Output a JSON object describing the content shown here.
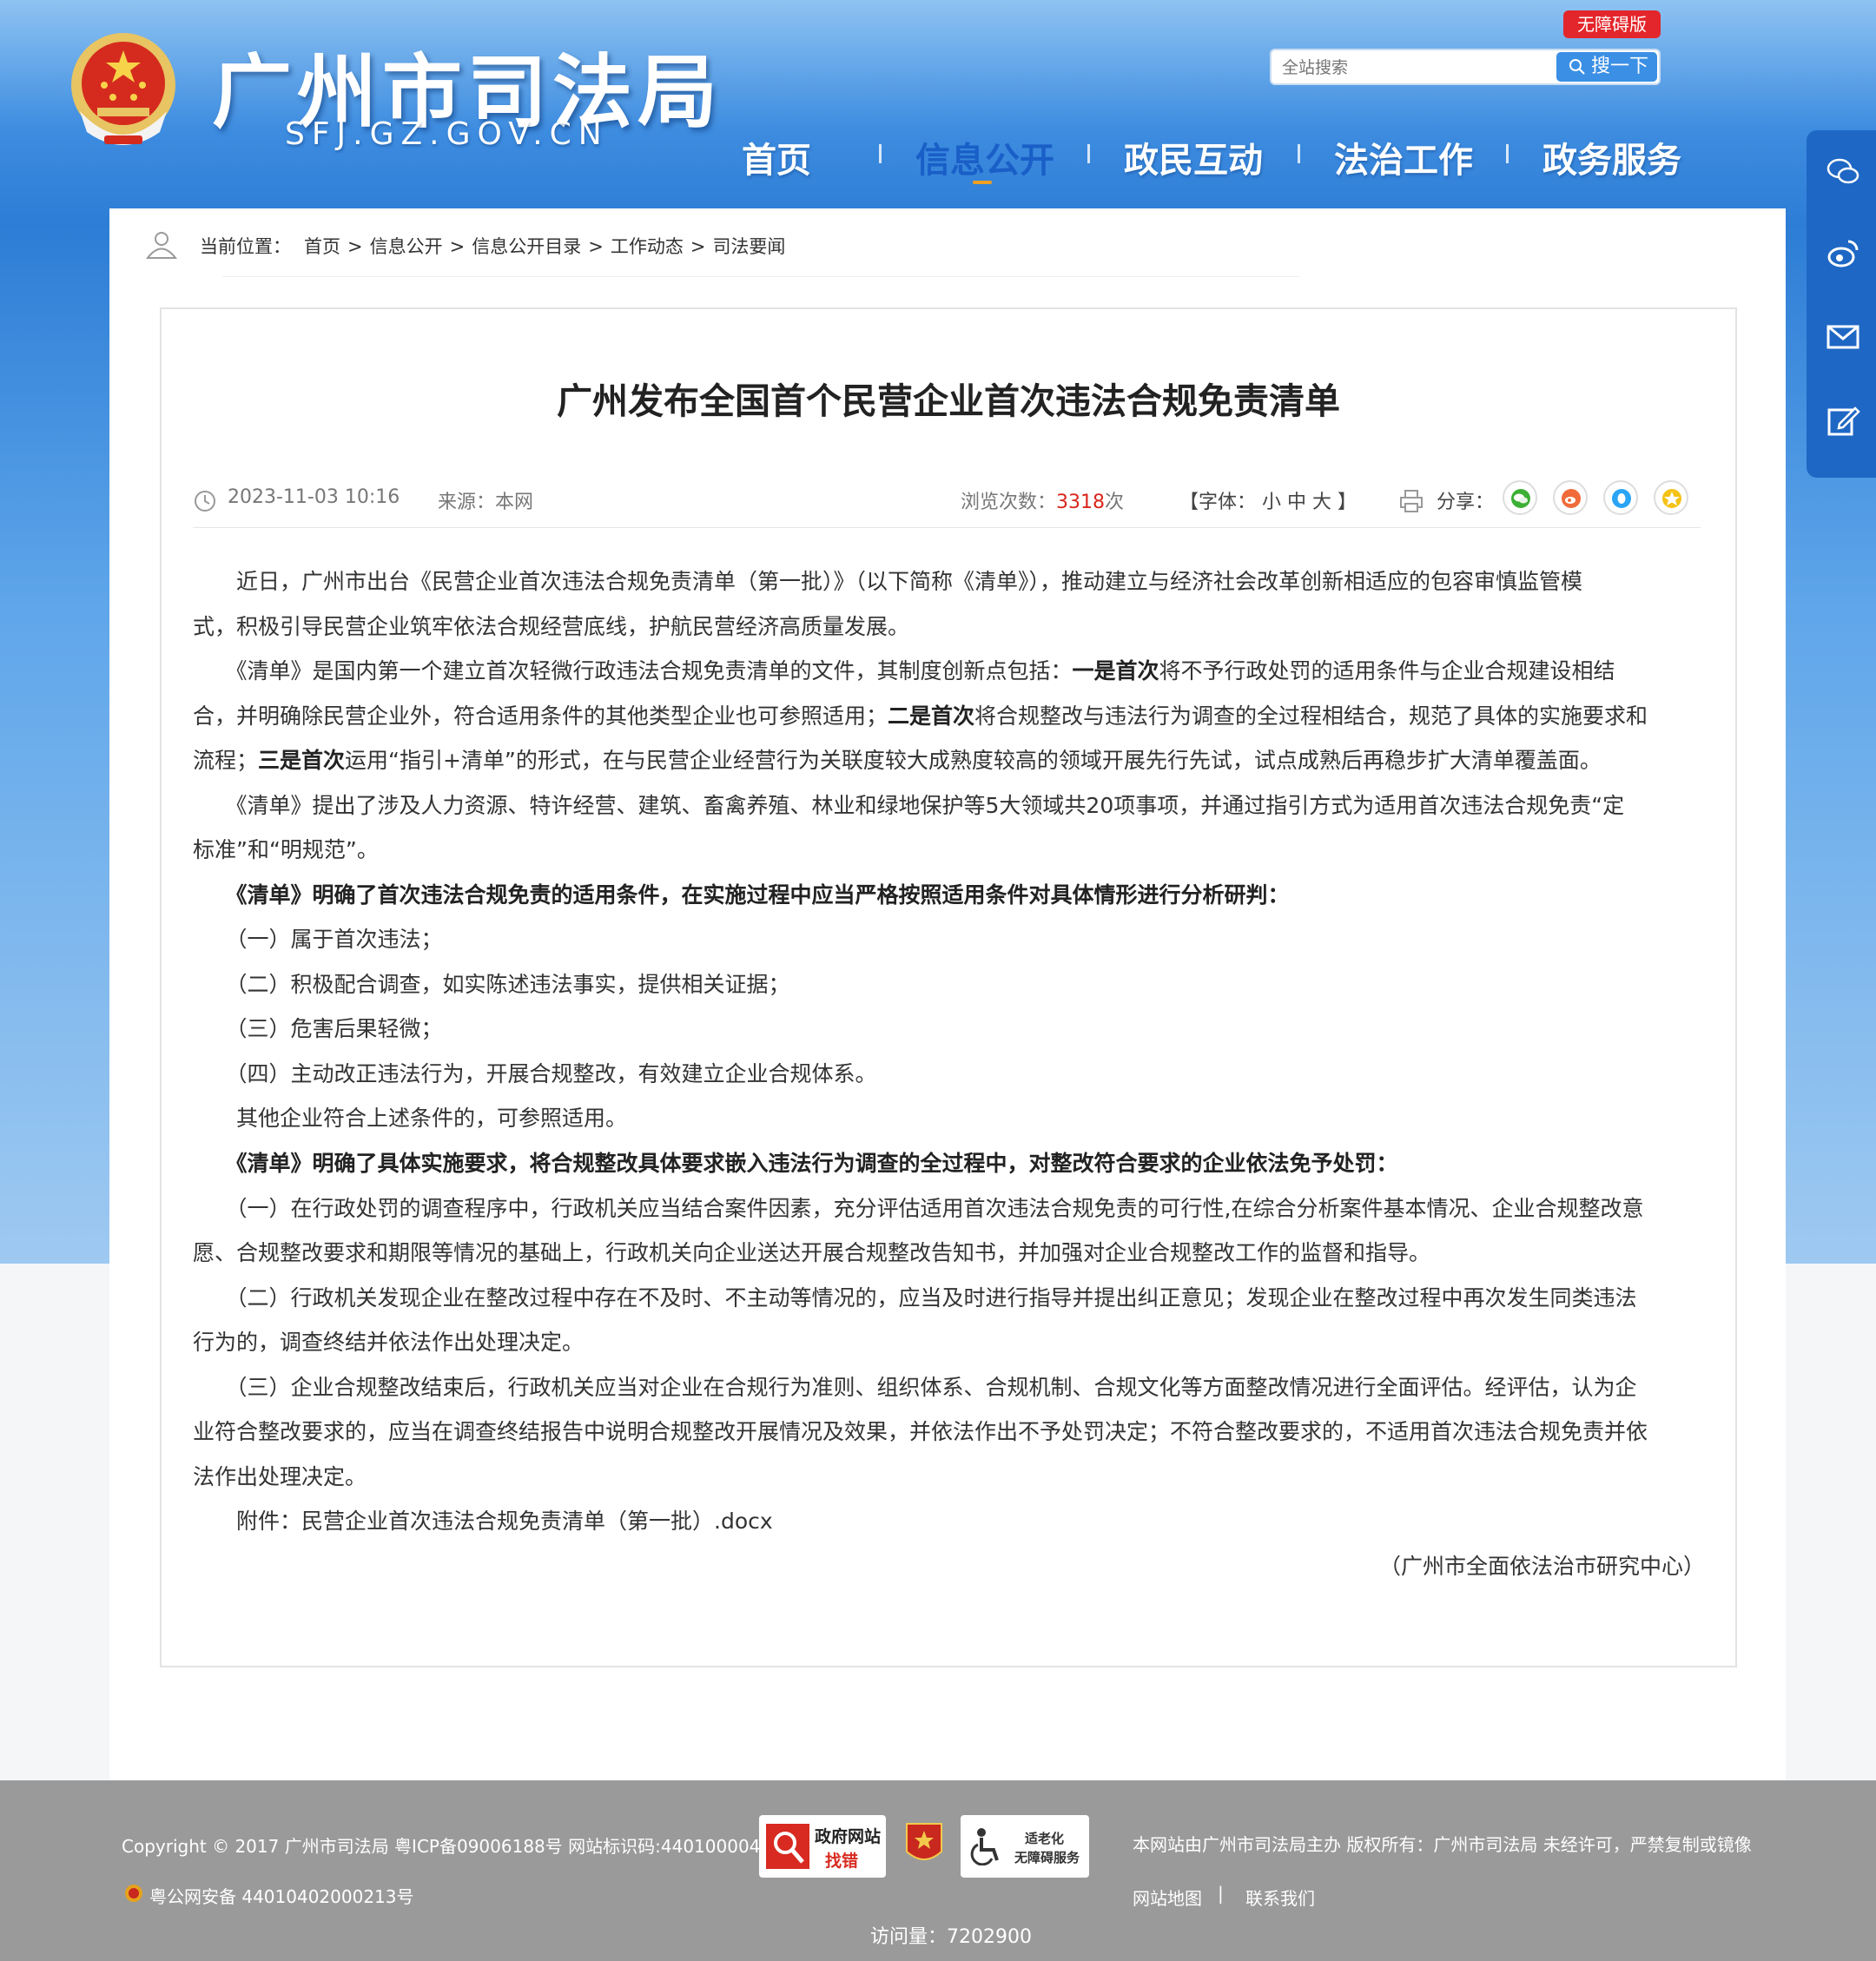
{
  "header": {
    "site_name": "广州市司法局",
    "site_domain": "SFJ.GZ.GOV.CN",
    "accessibility_label": "无障碍版",
    "search_placeholder": "全站搜索",
    "search_button": "搜一下"
  },
  "nav": {
    "items": [
      "首页",
      "信息公开",
      "政民互动",
      "法治工作",
      "政务服务"
    ],
    "active": "信息公开"
  },
  "side_tools": [
    "wechat-icon",
    "weibo-icon",
    "mail-icon",
    "edit-icon"
  ],
  "breadcrumb": {
    "label": "当前位置：",
    "items": [
      "首页",
      "信息公开",
      "信息公开目录",
      "工作动态",
      "司法要闻"
    ],
    "separator": ">"
  },
  "article": {
    "title": "广州发布全国首个民营企业首次违法合规免责清单",
    "date": "2023-11-03 10:16",
    "source": "来源：本网",
    "views_label": "浏览次数：",
    "views_value": "3318",
    "views_unit": "次",
    "font_size_label": "【字体： 小 中 大 】",
    "share_label": "分享：",
    "share_icons": [
      "wechat-icon",
      "weibo-icon",
      "qq-icon",
      "qzone-icon"
    ],
    "lines": {
      "p1a": "　　近日，广州市出台《民营企业首次违法合规免责清单（第一批）》（以下简称《清单》），推动建立与经济社会改革创新相适应的包容审慎监管模",
      "p1b": "式，积极引导民营企业筑牢依法合规经营底线，护航民营经济高质量发展。",
      "p2a_1": "　　《清单》是国内第一个建立首次轻微行政违法合规免责清单的文件，其制度创新点包括：",
      "p2a_b": "一是首次",
      "p2a_2": "将不予行政处罚的适用条件与企业合规建设相结",
      "p2b_1": "合，并明确除民营企业外，符合适用条件的其他类型企业也可参照适用；",
      "p2b_b": "二是首次",
      "p2b_2": "将合规整改与违法行为调查的全过程相结合，规范了具体的实施要求和",
      "p2c_1": "流程；",
      "p2c_b": "三是首次",
      "p2c_2": "运用“指引+清单”的形式，在与民营企业经营行为关联度较大成熟度较高的领域开展先行先试，试点成熟后再稳步扩大清单覆盖面。",
      "p3a": "　　《清单》提出了涉及人力资源、特许经营、建筑、畜禽养殖、林业和绿地保护等5大领域共20项事项，并通过指引方式为适用首次违法合规免责“定",
      "p3b": "标准”和“明规范”。",
      "p4": "　　《清单》明确了首次违法合规免责的适用条件，在实施过程中应当严格按照适用条件对具体情形进行分析研判：",
      "c1": "　　（一）属于首次违法；",
      "c2": "　　（二）积极配合调查，如实陈述违法事实，提供相关证据；",
      "c3": "　　（三）危害后果轻微；",
      "c4": "　　（四）主动改正违法行为，开展合规整改，有效建立企业合规体系。",
      "p5": "　　其他企业符合上述条件的，可参照适用。",
      "p6": "　　《清单》明确了具体实施要求，将合规整改具体要求嵌入违法行为调查的全过程中，对整改符合要求的企业依法免予处罚：",
      "r1a": "　　（一）在行政处罚的调查程序中，行政机关应当结合案件因素，充分评估适用首次违法合规免责的可行性,在综合分析案件基本情况、企业合规整改意",
      "r1b": "愿、合规整改要求和期限等情况的基础上，行政机关向企业送达开展合规整改告知书，并加强对企业合规整改工作的监督和指导。",
      "r2a": "　　（二）行政机关发现企业在整改过程中存在不及时、不主动等情况的，应当及时进行指导并提出纠正意见；发现企业在整改过程中再次发生同类违法",
      "r2b": "行为的，调查终结并依法作出处理决定。",
      "r3a": "　　（三）企业合规整改结束后，行政机关应当对企业在合规行为准则、组织体系、合规机制、合规文化等方面整改情况进行全面评估。经评估，认为企",
      "r3b": "业符合整改要求的，应当在调查终结报告中说明合规整改开展情况及效果，并依法作出不予处罚决定；不符合整改要求的，不适用首次违法合规免责并依",
      "r3c": "法作出处理决定。",
      "att": "　　附件：民营企业首次违法合规免责清单（第一批）.docx"
    },
    "signature": "（广州市全面依法治市研究中心）"
  },
  "footer": {
    "copyright": "Copyright © 2017 广州市司法局 粤ICP备09006188号 网站标识码:4401000042",
    "police": "粤公网安备 44010402000213号",
    "badge1_top": "政府网站",
    "badge1_bottom": "找错",
    "badge3_top": "适老化",
    "badge3_bottom": "无障碍服务",
    "rights": "本网站由广州市司法局主办 版权所有：广州市司法局 未经许可，严禁复制或镜像",
    "sitemap": "网站地图",
    "contact": "联系我们",
    "visits_label": "访问量：",
    "visits_value": "7202900"
  },
  "colors": {
    "brand_blue": "#2d7dd6",
    "nav_active": "#1a5fc7",
    "accent_red": "#d9261c",
    "footer_gray": "#9a9a9a"
  }
}
